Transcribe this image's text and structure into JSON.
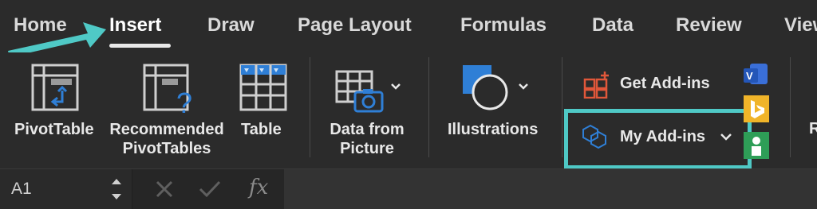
{
  "tabs": [
    {
      "label": "Home"
    },
    {
      "label": "Insert"
    },
    {
      "label": "Draw"
    },
    {
      "label": "Page Layout"
    },
    {
      "label": "Formulas"
    },
    {
      "label": "Data"
    },
    {
      "label": "Review"
    },
    {
      "label": "View"
    }
  ],
  "ribbon": {
    "pivottable": "PivotTable",
    "recommended_line1": "Recommended",
    "recommended_line2": "PivotTables",
    "table": "Table",
    "data_from_picture_line1": "Data from",
    "data_from_picture_line2": "Picture",
    "illustrations": "Illustrations",
    "get_addins": "Get Add-ins",
    "my_addins": "My Add-ins",
    "partial_next": "R"
  },
  "formula_bar": {
    "name_box": "A1",
    "fx": "fx"
  },
  "colors": {
    "accent": "#4fc9c6",
    "blue": "#2f7fd6",
    "orange_red": "#e0573a"
  }
}
